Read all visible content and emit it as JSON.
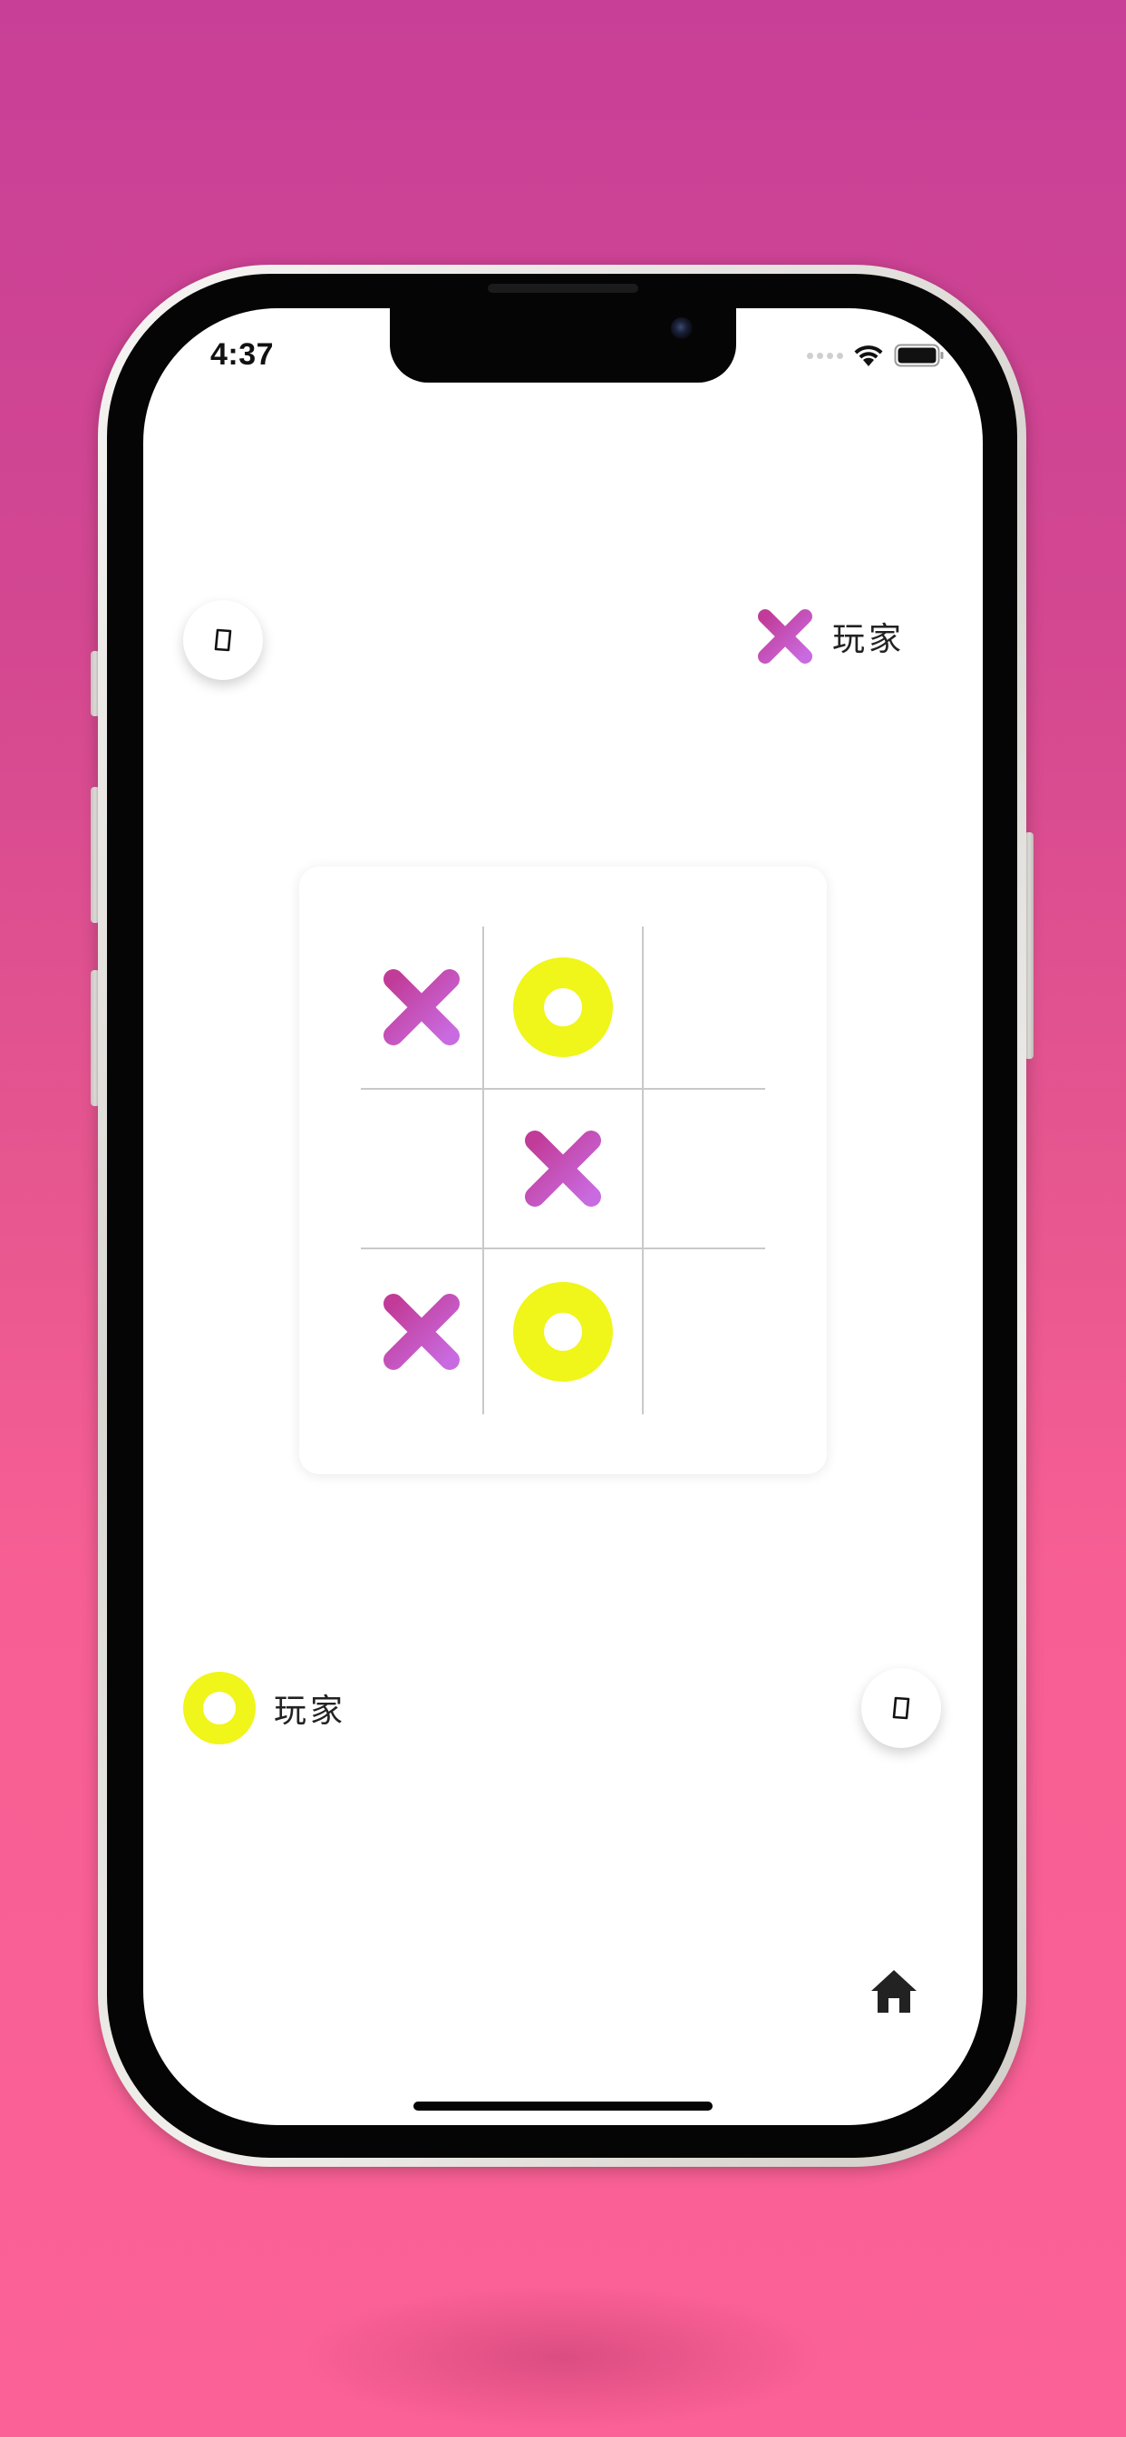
{
  "status_bar": {
    "time": "4:37",
    "icons": [
      "signal-dots-icon",
      "wifi-icon",
      "battery-icon"
    ]
  },
  "top_player": {
    "mark": "X",
    "icon": "x-mark-icon",
    "label": "玩家"
  },
  "bottom_player": {
    "mark": "O",
    "icon": "o-mark-icon",
    "label": "玩家"
  },
  "buttons": {
    "top_left": "card-icon",
    "bottom_right": "card-icon",
    "home": "home-icon"
  },
  "board": [
    [
      "X",
      "O",
      ""
    ],
    [
      "",
      "X",
      ""
    ],
    [
      "X",
      "O",
      ""
    ]
  ],
  "colors": {
    "background_top": "#c83f97",
    "background_bottom": "#fb6196",
    "x_gradient_start": "#c13b98",
    "x_gradient_end": "#c96be0",
    "o_color": "#f0f51a",
    "grid_line": "#c9c9c9"
  }
}
